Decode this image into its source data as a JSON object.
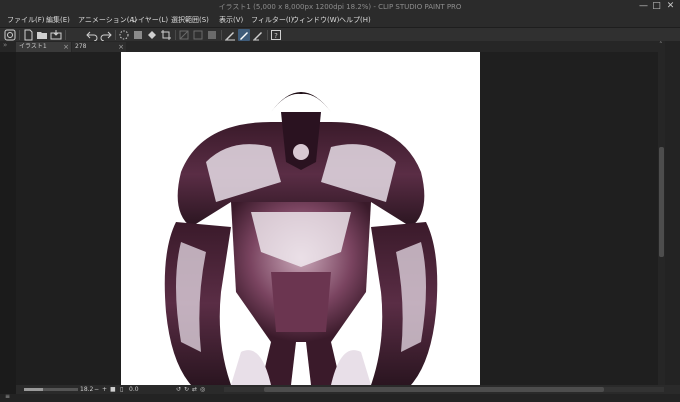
{
  "window": {
    "title": "イラスト1 (5,000 x 8,000px 1200dpi 18.2%) - CLIP STUDIO PAINT PRO",
    "minimize_glyph": "—",
    "maximize_glyph": "□",
    "close_glyph": "✕"
  },
  "menu": [
    {
      "label": "ファイル(F)"
    },
    {
      "label": "編集(E)"
    },
    {
      "label": "アニメーション(A)"
    },
    {
      "label": "レイヤー(L)"
    },
    {
      "label": "選択範囲(S)"
    },
    {
      "label": "表示(V)"
    },
    {
      "label": "フィルター(I)"
    },
    {
      "label": "ウィンドウ(W)"
    },
    {
      "label": "ヘルプ(H)"
    }
  ],
  "toolbar": {
    "icons": [
      "clip-studio-icon",
      "new-file-icon",
      "open-folder-icon",
      "save-icon",
      "undo-icon",
      "redo-icon",
      "erase-selection-icon",
      "clear-outside-icon",
      "fill-icon",
      "crop-icon",
      "transform-icon",
      "transform-layer-icon",
      "flip-icon",
      "pen-pressure-icon",
      "pen-active-icon",
      "pen-setting-icon",
      "help-icon"
    ]
  },
  "tabs": [
    {
      "label": "イラスト1",
      "active": true
    },
    {
      "label": "278",
      "active": false
    }
  ],
  "status": {
    "zoom": "18.2",
    "zoom_fraction": 0.35,
    "angle": "0.0",
    "left_glyph": "≡"
  },
  "colors": {
    "background": "#1f1f1f",
    "artboard": "#ffffff",
    "active_tool": "#3f5c7a"
  }
}
